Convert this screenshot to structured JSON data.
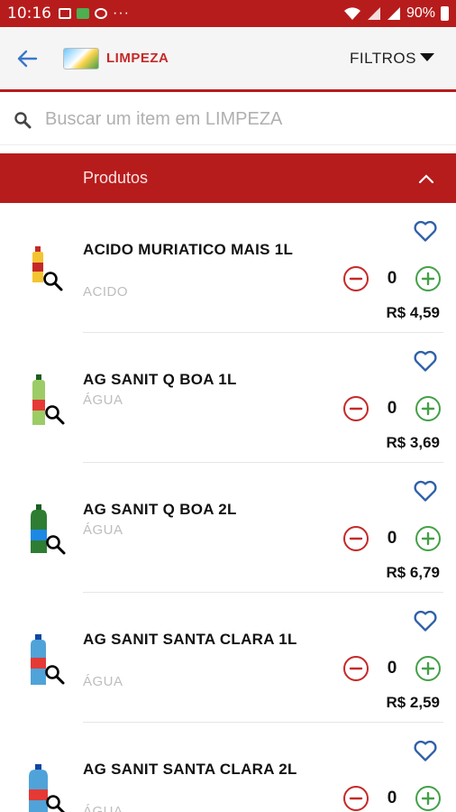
{
  "status_bar": {
    "time": "10:16",
    "dots": "···",
    "battery": "90%"
  },
  "header": {
    "back_icon": "arrow-left-icon",
    "title": "LIMPEZA",
    "filters_label": "FILTROS"
  },
  "search": {
    "placeholder": "Buscar um item em LIMPEZA",
    "value": ""
  },
  "section": {
    "label": "Produtos",
    "state": "expanded"
  },
  "colors": {
    "brand_red": "#b71c1c",
    "back_blue": "#3a77c8",
    "minus_red": "#c62828",
    "plus_green": "#43a047",
    "heart_blue": "#2f5fa8"
  },
  "products": [
    {
      "name": "ACIDO MURIATICO MAIS 1L",
      "category": "ACIDO",
      "qty": "0",
      "price": "R$ 4,59",
      "image": "yellow-bottle"
    },
    {
      "name": "AG SANIT Q BOA 1L",
      "category": "ÁGUA",
      "qty": "0",
      "price": "R$ 3,69",
      "image": "green-bottle"
    },
    {
      "name": "AG SANIT Q BOA 2L",
      "category": "ÁGUA",
      "qty": "0",
      "price": "R$ 6,79",
      "image": "dark-green-bottle"
    },
    {
      "name": "AG SANIT SANTA CLARA 1L",
      "category": "ÁGUA",
      "qty": "0",
      "price": "R$ 2,59",
      "image": "blue-bottle"
    },
    {
      "name": "AG SANIT SANTA CLARA 2L",
      "category": "ÁGUA",
      "qty": "0",
      "price": "",
      "image": "blue-bottle"
    }
  ]
}
